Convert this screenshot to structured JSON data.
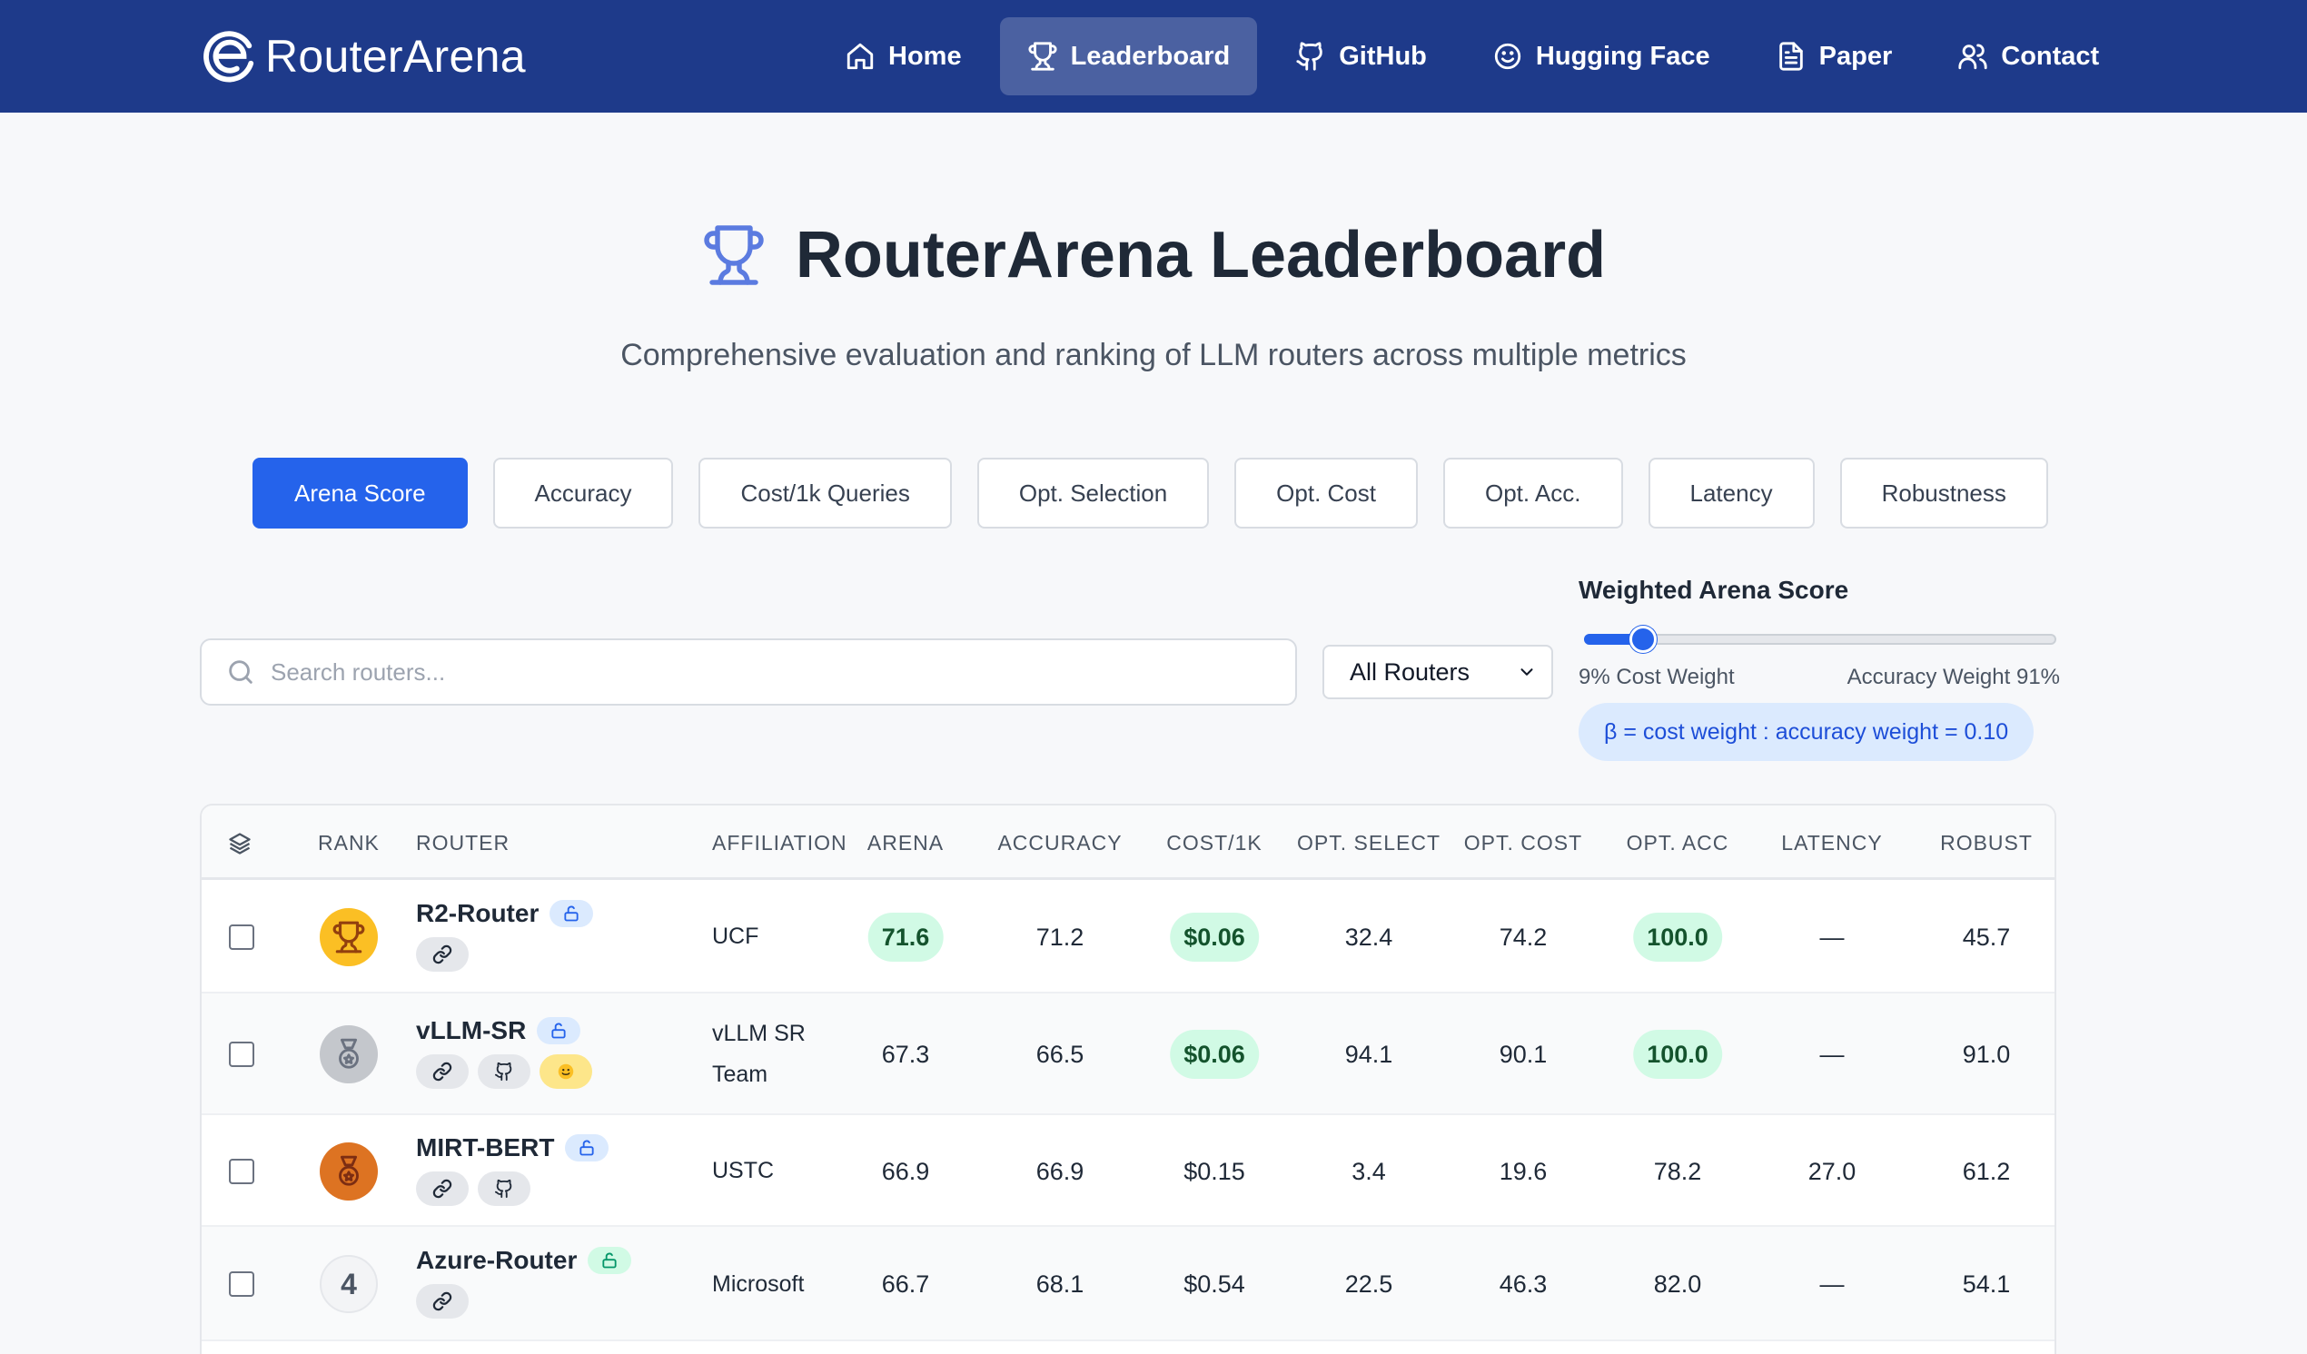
{
  "brand": {
    "name": "RouterArena"
  },
  "nav": [
    {
      "label": "Home",
      "icon": "home-icon",
      "active": false
    },
    {
      "label": "Leaderboard",
      "icon": "trophy-icon",
      "active": true
    },
    {
      "label": "GitHub",
      "icon": "github-icon",
      "active": false
    },
    {
      "label": "Hugging Face",
      "icon": "smile-icon",
      "active": false
    },
    {
      "label": "Paper",
      "icon": "document-icon",
      "active": false
    },
    {
      "label": "Contact",
      "icon": "users-icon",
      "active": false
    }
  ],
  "hero": {
    "title": "RouterArena Leaderboard",
    "subtitle": "Comprehensive evaluation and ranking of LLM routers across multiple metrics"
  },
  "tabs": [
    {
      "label": "Arena Score",
      "active": true
    },
    {
      "label": "Accuracy",
      "active": false
    },
    {
      "label": "Cost/1k Queries",
      "active": false
    },
    {
      "label": "Opt. Selection",
      "active": false
    },
    {
      "label": "Opt. Cost",
      "active": false
    },
    {
      "label": "Opt. Acc.",
      "active": false
    },
    {
      "label": "Latency",
      "active": false
    },
    {
      "label": "Robustness",
      "active": false
    }
  ],
  "search": {
    "placeholder": "Search routers...",
    "value": ""
  },
  "filter": {
    "selected": "All Routers"
  },
  "weight": {
    "title": "Weighted Arena Score",
    "cost_weight_pct": 9,
    "cost_label": "9% Cost Weight",
    "accuracy_label": "Accuracy Weight 91%",
    "beta_text": "β = cost weight : accuracy weight = 0.10"
  },
  "table": {
    "columns": {
      "rank": "RANK",
      "router": "ROUTER",
      "affiliation": "AFFILIATION",
      "arena": "ARENA",
      "accuracy": "ACCURACY",
      "cost": "COST/1K",
      "opt_select": "OPT. SELECT",
      "opt_cost": "OPT. COST",
      "opt_acc": "OPT. ACC",
      "latency": "LATENCY",
      "robust": "ROBUST"
    },
    "rows": [
      {
        "rank": "1",
        "medal": "gold",
        "name": "R2-Router",
        "lock": "blue",
        "links": [
          "link-icon"
        ],
        "affiliation": [
          "UCF"
        ],
        "arena": "71.6",
        "arena_hl": true,
        "accuracy": "71.2",
        "cost": "$0.06",
        "cost_hl": true,
        "opt_select": "32.4",
        "opt_cost": "74.2",
        "opt_acc": "100.0",
        "opt_acc_hl": true,
        "latency": "—",
        "robust": "45.7"
      },
      {
        "rank": "2",
        "medal": "silver",
        "name": "vLLM-SR",
        "lock": "blue",
        "links": [
          "link-icon",
          "github-icon",
          "huggingface-icon"
        ],
        "affiliation": [
          "vLLM SR",
          "Team"
        ],
        "arena": "67.3",
        "arena_hl": false,
        "accuracy": "66.5",
        "cost": "$0.06",
        "cost_hl": true,
        "opt_select": "94.1",
        "opt_cost": "90.1",
        "opt_acc": "100.0",
        "opt_acc_hl": true,
        "latency": "—",
        "robust": "91.0"
      },
      {
        "rank": "3",
        "medal": "bronze",
        "name": "MIRT-BERT",
        "lock": "blue",
        "links": [
          "link-icon",
          "github-icon"
        ],
        "affiliation": [
          "USTC"
        ],
        "arena": "66.9",
        "arena_hl": false,
        "accuracy": "66.9",
        "cost": "$0.15",
        "cost_hl": false,
        "opt_select": "3.4",
        "opt_cost": "19.6",
        "opt_acc": "78.2",
        "opt_acc_hl": false,
        "latency": "27.0",
        "robust": "61.2"
      },
      {
        "rank": "4",
        "medal": "none",
        "name": "Azure-Router",
        "lock": "green",
        "links": [
          "link-icon"
        ],
        "affiliation": [
          "Microsoft"
        ],
        "arena": "66.7",
        "arena_hl": false,
        "accuracy": "68.1",
        "cost": "$0.54",
        "cost_hl": false,
        "opt_select": "22.5",
        "opt_cost": "46.3",
        "opt_acc": "82.0",
        "opt_acc_hl": false,
        "latency": "—",
        "robust": "54.1"
      }
    ]
  }
}
